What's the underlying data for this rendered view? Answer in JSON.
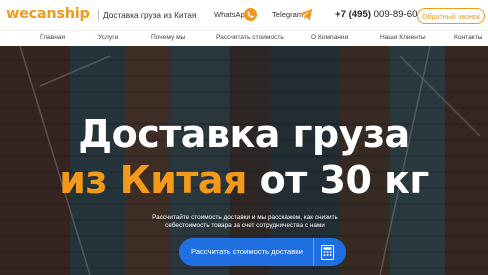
{
  "header": {
    "logo": "wecanship",
    "tagline": "Доставка груза из Китая",
    "whatsapp_label": "WhatsApp",
    "whatsapp_icon": "phone-circle-icon",
    "telegram_label": "Telegram",
    "telegram_icon": "paper-plane-icon",
    "phone_prefix": "+7 (495)",
    "phone_number": " 009-89-60",
    "callback_label": "Обратный звонок"
  },
  "nav": {
    "items": [
      {
        "label": "Главная"
      },
      {
        "label": "Услуги"
      },
      {
        "label": "Почему мы"
      },
      {
        "label": "Рассчитать стоимость"
      },
      {
        "label": "О Компании"
      },
      {
        "label": "Наши Клиенты"
      },
      {
        "label": "Контакты"
      }
    ]
  },
  "hero": {
    "title_line1": "Доставка груза",
    "title_accent": "из Китая",
    "title_rest": " от 30 кг",
    "subtitle": "Рассчитайте стоимость доставки и мы расскажем, как снизить себестоимость товара за счет сотрудничества с нами",
    "cta_label": "Рассчитать стоимость доставки",
    "cta_icon": "calculator-icon"
  },
  "colors": {
    "accent": "#f49a1a",
    "cta": "#1f6fe0"
  }
}
